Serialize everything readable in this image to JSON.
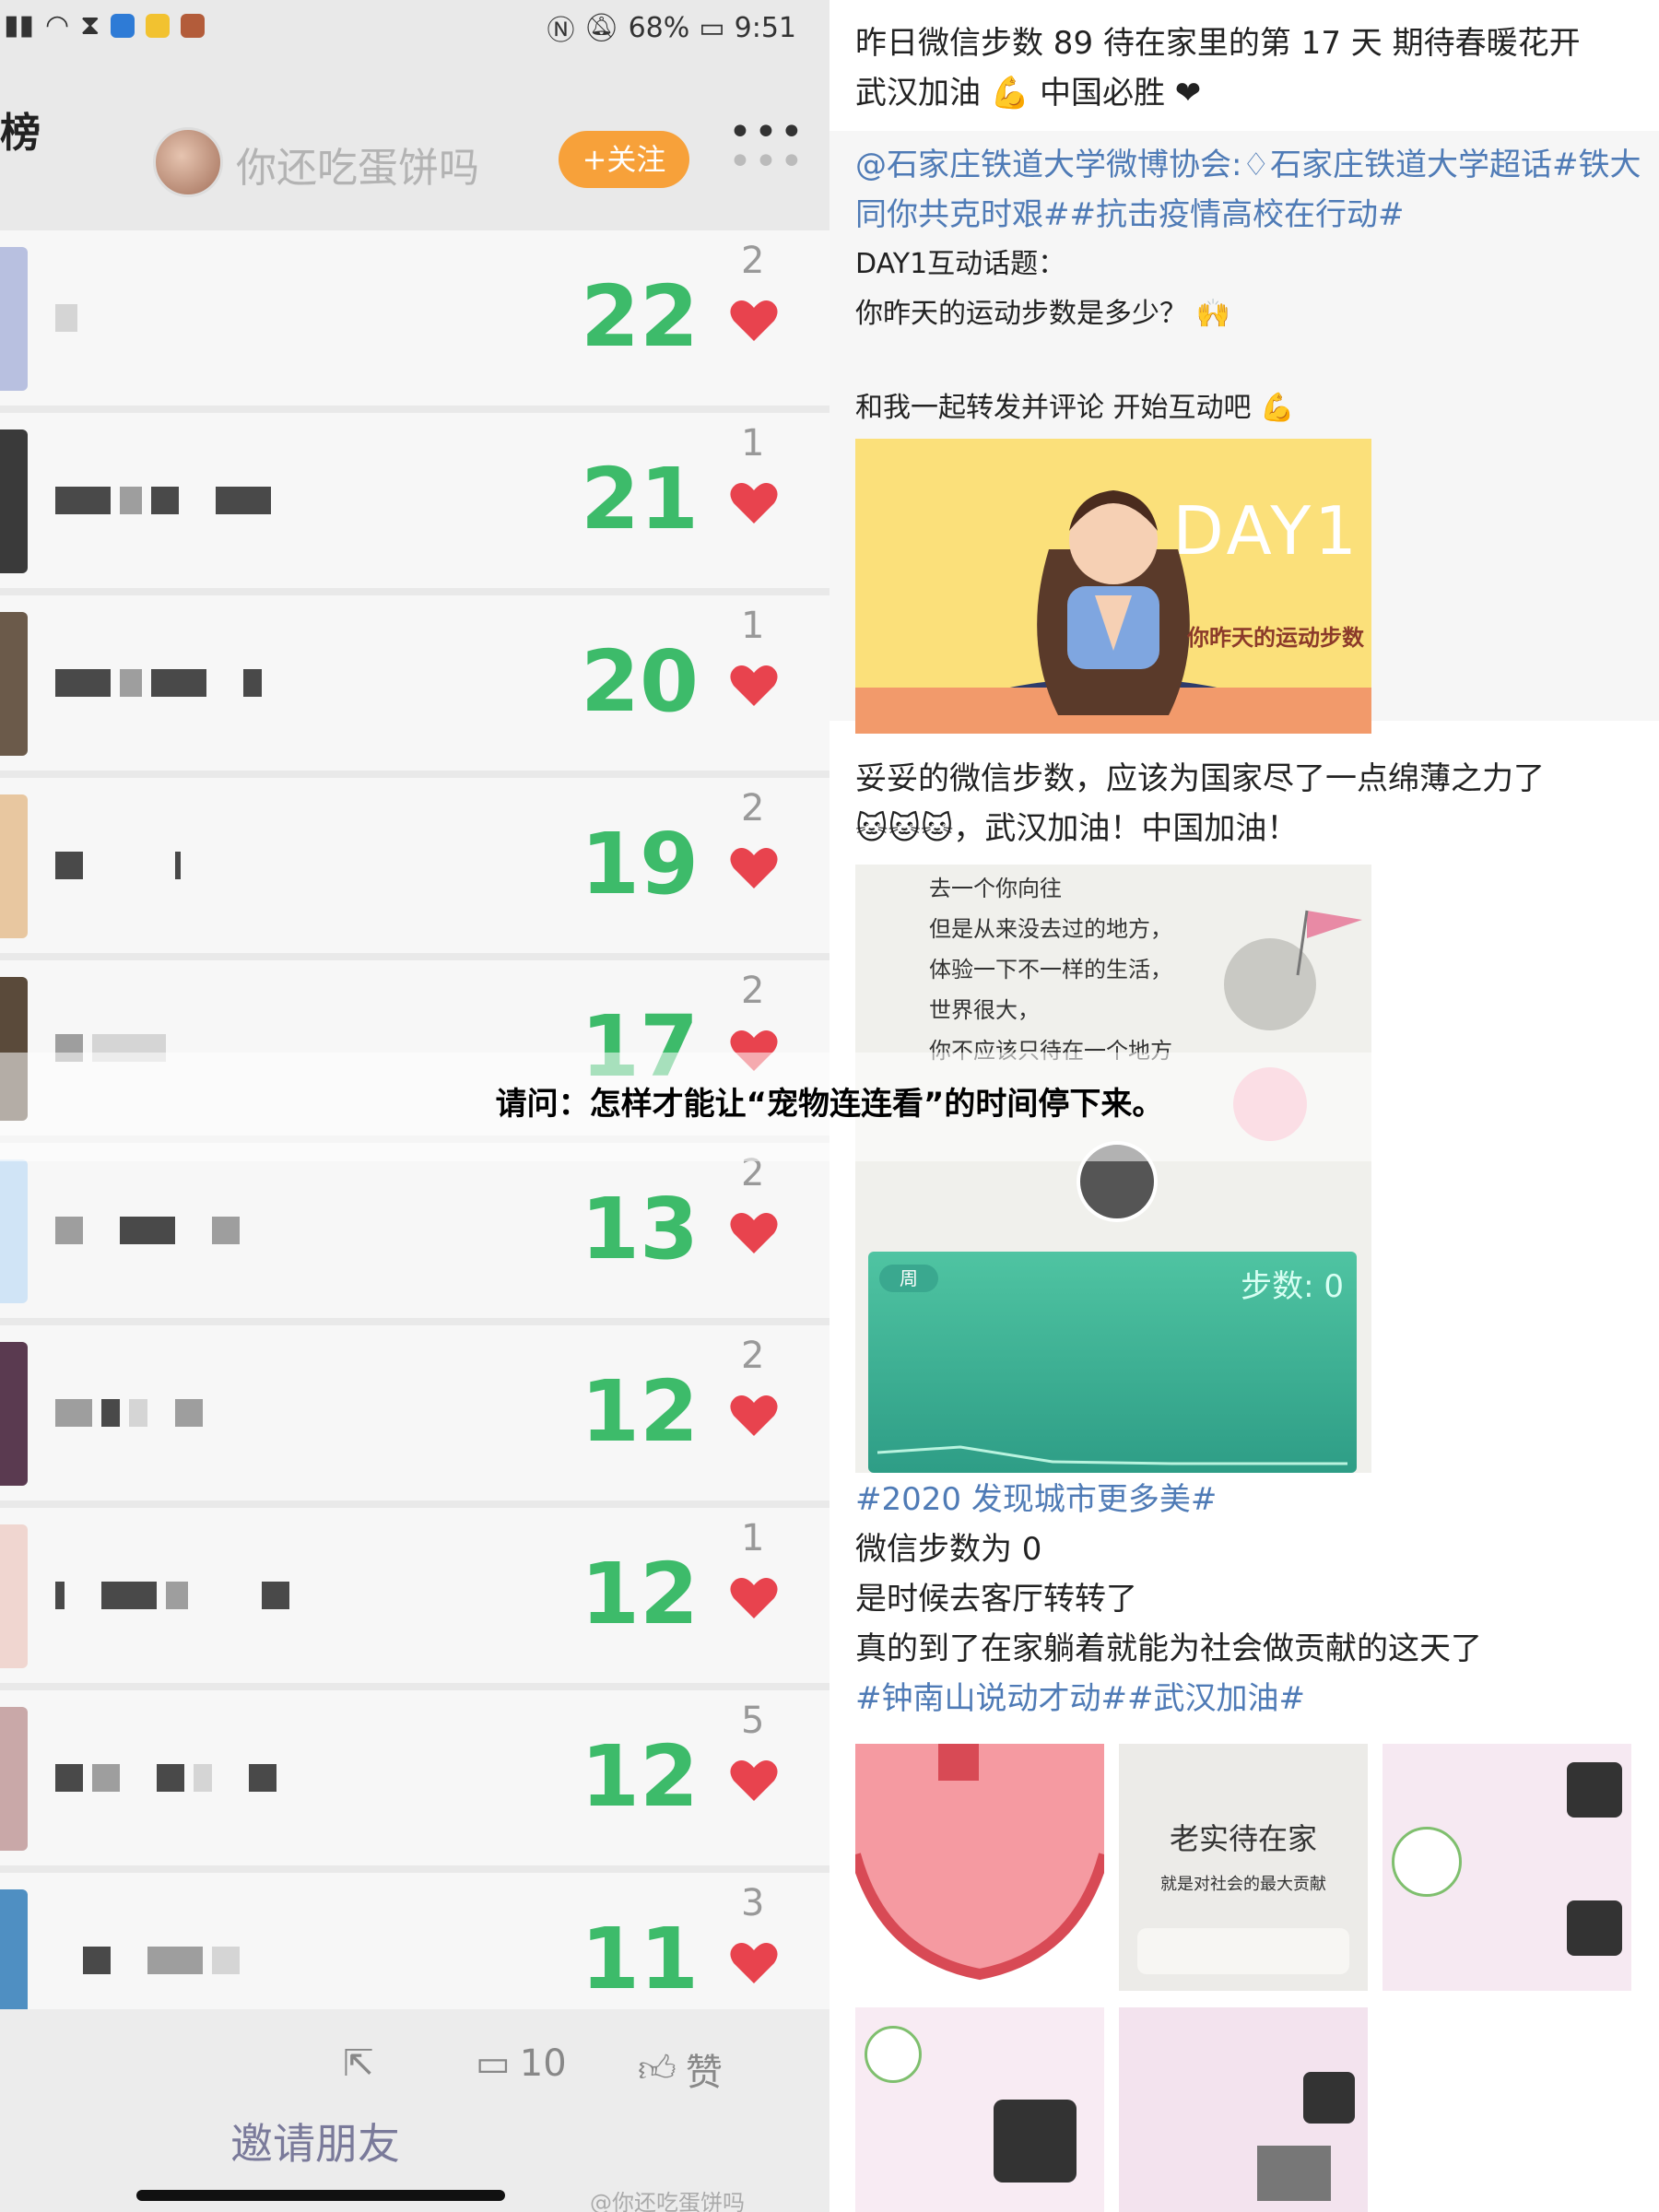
{
  "status_bar": {
    "battery": "68%",
    "time": "9:51"
  },
  "header": {
    "title": "榜",
    "username": "你还吃蛋饼吗",
    "follow_label": "+关注",
    "more": "•••"
  },
  "rows": [
    {
      "steps": "22",
      "likes": "2"
    },
    {
      "steps": "21",
      "likes": "1"
    },
    {
      "steps": "20",
      "likes": "1"
    },
    {
      "steps": "19",
      "likes": "2"
    },
    {
      "steps": "17",
      "likes": "2"
    },
    {
      "steps": "13",
      "likes": "2"
    },
    {
      "steps": "12",
      "likes": "2"
    },
    {
      "steps": "12",
      "likes": "1"
    },
    {
      "steps": "12",
      "likes": "5"
    },
    {
      "steps": "11",
      "likes": "3"
    }
  ],
  "bottom_bar": {
    "comments": "10",
    "like_label": "赞",
    "invite_label": "邀请朋友",
    "watermark": "@你还吃蛋饼吗"
  },
  "right": {
    "post1": {
      "line1": "昨日微信步数 89 待在家里的第 17 天 期待春暖花开",
      "line2": "武汉加油 💪 中国必胜 ❤"
    },
    "post2": {
      "mention": "@石家庄铁道大学微博协会:",
      "topic1": "石家庄铁道大学超话#铁大同你共克时艰##抗击疫情高校在行动#",
      "line1": "DAY1互动话题：",
      "line2": "你昨天的运动步数是多少？ 🙌",
      "line3": "和我一起转发并评论  开始互动吧 💪",
      "image_title": "DAY1",
      "image_sub": "你昨天的运动步数"
    },
    "post3": {
      "line1": "妥妥的微信步数，应该为国家尽了一点绵薄之力了",
      "line2": "，武汉加油！中国加油！",
      "poem": [
        "去一个你向往",
        "但是从来没去过的地方，",
        "体验一下不一样的生活，",
        "世界很大，",
        "你不应该只待在一个地方"
      ],
      "app_toggle": "周",
      "app_steps": "步数: 0"
    },
    "post4": {
      "topic": "#2020 发现城市更多美#",
      "line1": "微信步数为 0",
      "line2": "是时候去客厅转转了",
      "line3": "真的到了在家躺着就能为社会做贡献的这天了",
      "topic2": "#钟南山说动才动##武汉加油#",
      "img2_title": "老实待在家",
      "img2_sub": "就是对社会的最大贡献"
    }
  },
  "caption": "请问：怎样才能让“宠物连连看”的时间停下来。",
  "colors": {
    "steps": "#3dbb6a",
    "heart": "#e8434e",
    "follow": "#f7a13a",
    "link": "#4f7bb6"
  }
}
